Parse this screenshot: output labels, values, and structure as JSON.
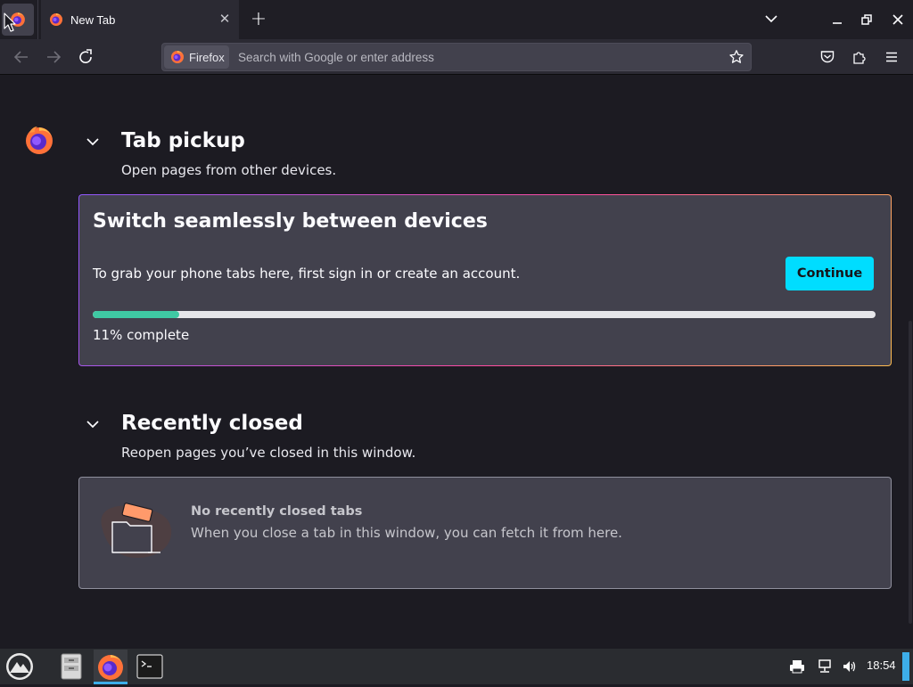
{
  "window": {
    "active_tab_title": "New Tab",
    "new_tab_symbol": "+",
    "close_symbol": "✕"
  },
  "navbar": {
    "identity_label": "Firefox",
    "url_placeholder": "Search with Google or enter address",
    "url_value": ""
  },
  "tab_pickup": {
    "title": "Tab pickup",
    "description": "Open pages from other devices.",
    "card": {
      "title": "Switch seamlessly between devices",
      "description": "To grab your phone tabs here, first sign in or create an account.",
      "button_label": "Continue",
      "progress_percent": 11,
      "progress_label": "11% complete"
    }
  },
  "recently_closed": {
    "title": "Recently closed",
    "description": "Reopen pages you’ve closed in this window.",
    "empty_title": "No recently closed tabs",
    "empty_description": "When you close a tab in this window, you can fetch it from here."
  },
  "taskbar": {
    "clock": "18:54"
  },
  "colors": {
    "accent": "#00ddff",
    "progress_fill": "#3fc9a3",
    "progress_track": "#e6e6ea",
    "card_bg": "#42414d",
    "page_bg": "#1c1b22",
    "taskbar_accent": "#3daee9"
  },
  "icons": [
    "firefox-icon",
    "close-icon",
    "plus-icon",
    "chevron-down-icon",
    "minimize-icon",
    "restore-icon",
    "back-icon",
    "forward-icon",
    "reload-icon",
    "star-icon",
    "pocket-icon",
    "extensions-icon",
    "menu-icon",
    "folder-icon",
    "file-manager-icon",
    "terminal-icon",
    "printer-icon",
    "network-icon",
    "volume-icon"
  ]
}
